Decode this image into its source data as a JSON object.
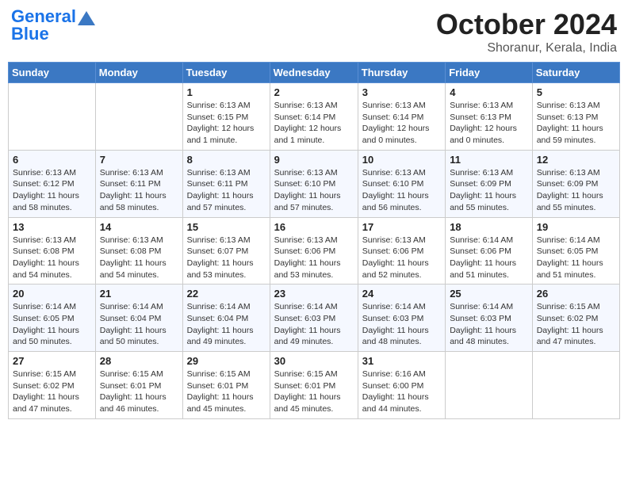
{
  "header": {
    "logo_line1": "General",
    "logo_line2": "Blue",
    "title": "October 2024",
    "subtitle": "Shoranur, Kerala, India"
  },
  "days_of_week": [
    "Sunday",
    "Monday",
    "Tuesday",
    "Wednesday",
    "Thursday",
    "Friday",
    "Saturday"
  ],
  "weeks": [
    [
      {
        "day": "",
        "info": ""
      },
      {
        "day": "",
        "info": ""
      },
      {
        "day": "1",
        "info": "Sunrise: 6:13 AM\nSunset: 6:15 PM\nDaylight: 12 hours and 1 minute."
      },
      {
        "day": "2",
        "info": "Sunrise: 6:13 AM\nSunset: 6:14 PM\nDaylight: 12 hours and 1 minute."
      },
      {
        "day": "3",
        "info": "Sunrise: 6:13 AM\nSunset: 6:14 PM\nDaylight: 12 hours and 0 minutes."
      },
      {
        "day": "4",
        "info": "Sunrise: 6:13 AM\nSunset: 6:13 PM\nDaylight: 12 hours and 0 minutes."
      },
      {
        "day": "5",
        "info": "Sunrise: 6:13 AM\nSunset: 6:13 PM\nDaylight: 11 hours and 59 minutes."
      }
    ],
    [
      {
        "day": "6",
        "info": "Sunrise: 6:13 AM\nSunset: 6:12 PM\nDaylight: 11 hours and 58 minutes."
      },
      {
        "day": "7",
        "info": "Sunrise: 6:13 AM\nSunset: 6:11 PM\nDaylight: 11 hours and 58 minutes."
      },
      {
        "day": "8",
        "info": "Sunrise: 6:13 AM\nSunset: 6:11 PM\nDaylight: 11 hours and 57 minutes."
      },
      {
        "day": "9",
        "info": "Sunrise: 6:13 AM\nSunset: 6:10 PM\nDaylight: 11 hours and 57 minutes."
      },
      {
        "day": "10",
        "info": "Sunrise: 6:13 AM\nSunset: 6:10 PM\nDaylight: 11 hours and 56 minutes."
      },
      {
        "day": "11",
        "info": "Sunrise: 6:13 AM\nSunset: 6:09 PM\nDaylight: 11 hours and 55 minutes."
      },
      {
        "day": "12",
        "info": "Sunrise: 6:13 AM\nSunset: 6:09 PM\nDaylight: 11 hours and 55 minutes."
      }
    ],
    [
      {
        "day": "13",
        "info": "Sunrise: 6:13 AM\nSunset: 6:08 PM\nDaylight: 11 hours and 54 minutes."
      },
      {
        "day": "14",
        "info": "Sunrise: 6:13 AM\nSunset: 6:08 PM\nDaylight: 11 hours and 54 minutes."
      },
      {
        "day": "15",
        "info": "Sunrise: 6:13 AM\nSunset: 6:07 PM\nDaylight: 11 hours and 53 minutes."
      },
      {
        "day": "16",
        "info": "Sunrise: 6:13 AM\nSunset: 6:06 PM\nDaylight: 11 hours and 53 minutes."
      },
      {
        "day": "17",
        "info": "Sunrise: 6:13 AM\nSunset: 6:06 PM\nDaylight: 11 hours and 52 minutes."
      },
      {
        "day": "18",
        "info": "Sunrise: 6:14 AM\nSunset: 6:06 PM\nDaylight: 11 hours and 51 minutes."
      },
      {
        "day": "19",
        "info": "Sunrise: 6:14 AM\nSunset: 6:05 PM\nDaylight: 11 hours and 51 minutes."
      }
    ],
    [
      {
        "day": "20",
        "info": "Sunrise: 6:14 AM\nSunset: 6:05 PM\nDaylight: 11 hours and 50 minutes."
      },
      {
        "day": "21",
        "info": "Sunrise: 6:14 AM\nSunset: 6:04 PM\nDaylight: 11 hours and 50 minutes."
      },
      {
        "day": "22",
        "info": "Sunrise: 6:14 AM\nSunset: 6:04 PM\nDaylight: 11 hours and 49 minutes."
      },
      {
        "day": "23",
        "info": "Sunrise: 6:14 AM\nSunset: 6:03 PM\nDaylight: 11 hours and 49 minutes."
      },
      {
        "day": "24",
        "info": "Sunrise: 6:14 AM\nSunset: 6:03 PM\nDaylight: 11 hours and 48 minutes."
      },
      {
        "day": "25",
        "info": "Sunrise: 6:14 AM\nSunset: 6:03 PM\nDaylight: 11 hours and 48 minutes."
      },
      {
        "day": "26",
        "info": "Sunrise: 6:15 AM\nSunset: 6:02 PM\nDaylight: 11 hours and 47 minutes."
      }
    ],
    [
      {
        "day": "27",
        "info": "Sunrise: 6:15 AM\nSunset: 6:02 PM\nDaylight: 11 hours and 47 minutes."
      },
      {
        "day": "28",
        "info": "Sunrise: 6:15 AM\nSunset: 6:01 PM\nDaylight: 11 hours and 46 minutes."
      },
      {
        "day": "29",
        "info": "Sunrise: 6:15 AM\nSunset: 6:01 PM\nDaylight: 11 hours and 45 minutes."
      },
      {
        "day": "30",
        "info": "Sunrise: 6:15 AM\nSunset: 6:01 PM\nDaylight: 11 hours and 45 minutes."
      },
      {
        "day": "31",
        "info": "Sunrise: 6:16 AM\nSunset: 6:00 PM\nDaylight: 11 hours and 44 minutes."
      },
      {
        "day": "",
        "info": ""
      },
      {
        "day": "",
        "info": ""
      }
    ]
  ]
}
